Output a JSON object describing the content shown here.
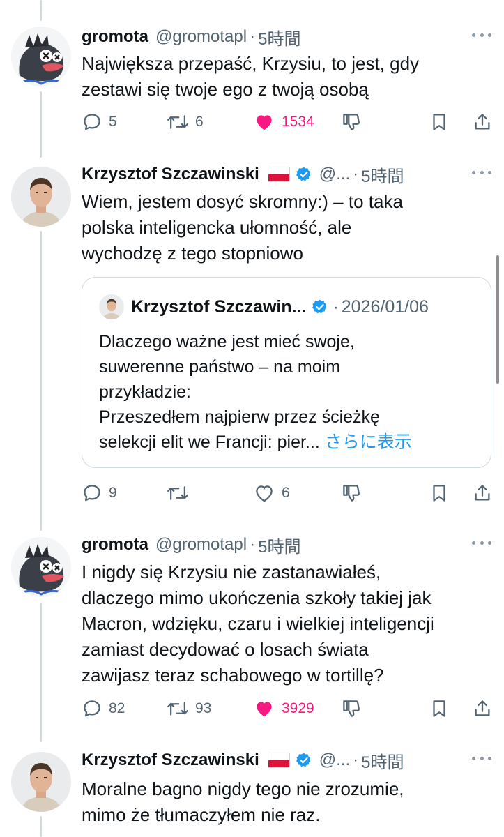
{
  "tweets": [
    {
      "name": "gromota",
      "handle": "@gromotapl",
      "time": "5時間",
      "text_lines": [
        "Największa przepaść, Krzysiu, to jest, gdy",
        "zestawi się twoje ego z twoją osobą"
      ],
      "replies": "5",
      "retweets": "6",
      "likes": "1534",
      "liked": true
    },
    {
      "name": "Krzysztof Szczawinski",
      "handle": "@...",
      "time": "5時間",
      "text_lines": [
        "Wiem, jestem dosyć skromny:) – to taka",
        "polska inteligencka ułomność, ale",
        "wychodzę z tego stopniowo"
      ],
      "replies": "9",
      "retweets": "",
      "likes": "6",
      "liked": false,
      "quote": {
        "name": "Krzysztof Szczawin...",
        "date": "2026/01/06",
        "text_lines": [
          "Dlaczego ważne jest mieć swoje,",
          "suwerenne państwo – na moim",
          "przykładzie:",
          "Przeszedłem najpierw przez ścieżkę"
        ],
        "last_line": "selekcji elit we Francji: pier...",
        "show_more": "さらに表示"
      }
    },
    {
      "name": "gromota",
      "handle": "@gromotapl",
      "time": "5時間",
      "text_lines": [
        "I nigdy się Krzysiu nie zastanawiałeś,",
        "dlaczego mimo ukończenia szkoły takiej jak",
        "Macron, wdzięku, czaru i wielkiej inteligencji",
        "zamiast decydować o losach świata",
        "zawijasz teraz schabowego w tortillę?"
      ],
      "replies": "82",
      "retweets": "93",
      "likes": "3929",
      "liked": true
    },
    {
      "name": "Krzysztof Szczawinski",
      "handle": "@...",
      "time": "5時間",
      "text_lines": [
        "Moralne bagno nigdy tego nie zrozumie,",
        "mimo że tłumaczyłem nie raz."
      ]
    }
  ],
  "colors": {
    "like_active": "#f91880",
    "verified": "#1d9bf0",
    "secondary_text": "#536471",
    "link": "#1d9bf0"
  },
  "icons": [
    "reply-icon",
    "retweet-icon",
    "like-icon",
    "downvote-icon",
    "bookmark-icon",
    "share-icon",
    "more-icon",
    "verified-badge-icon",
    "poland-flag-icon"
  ]
}
